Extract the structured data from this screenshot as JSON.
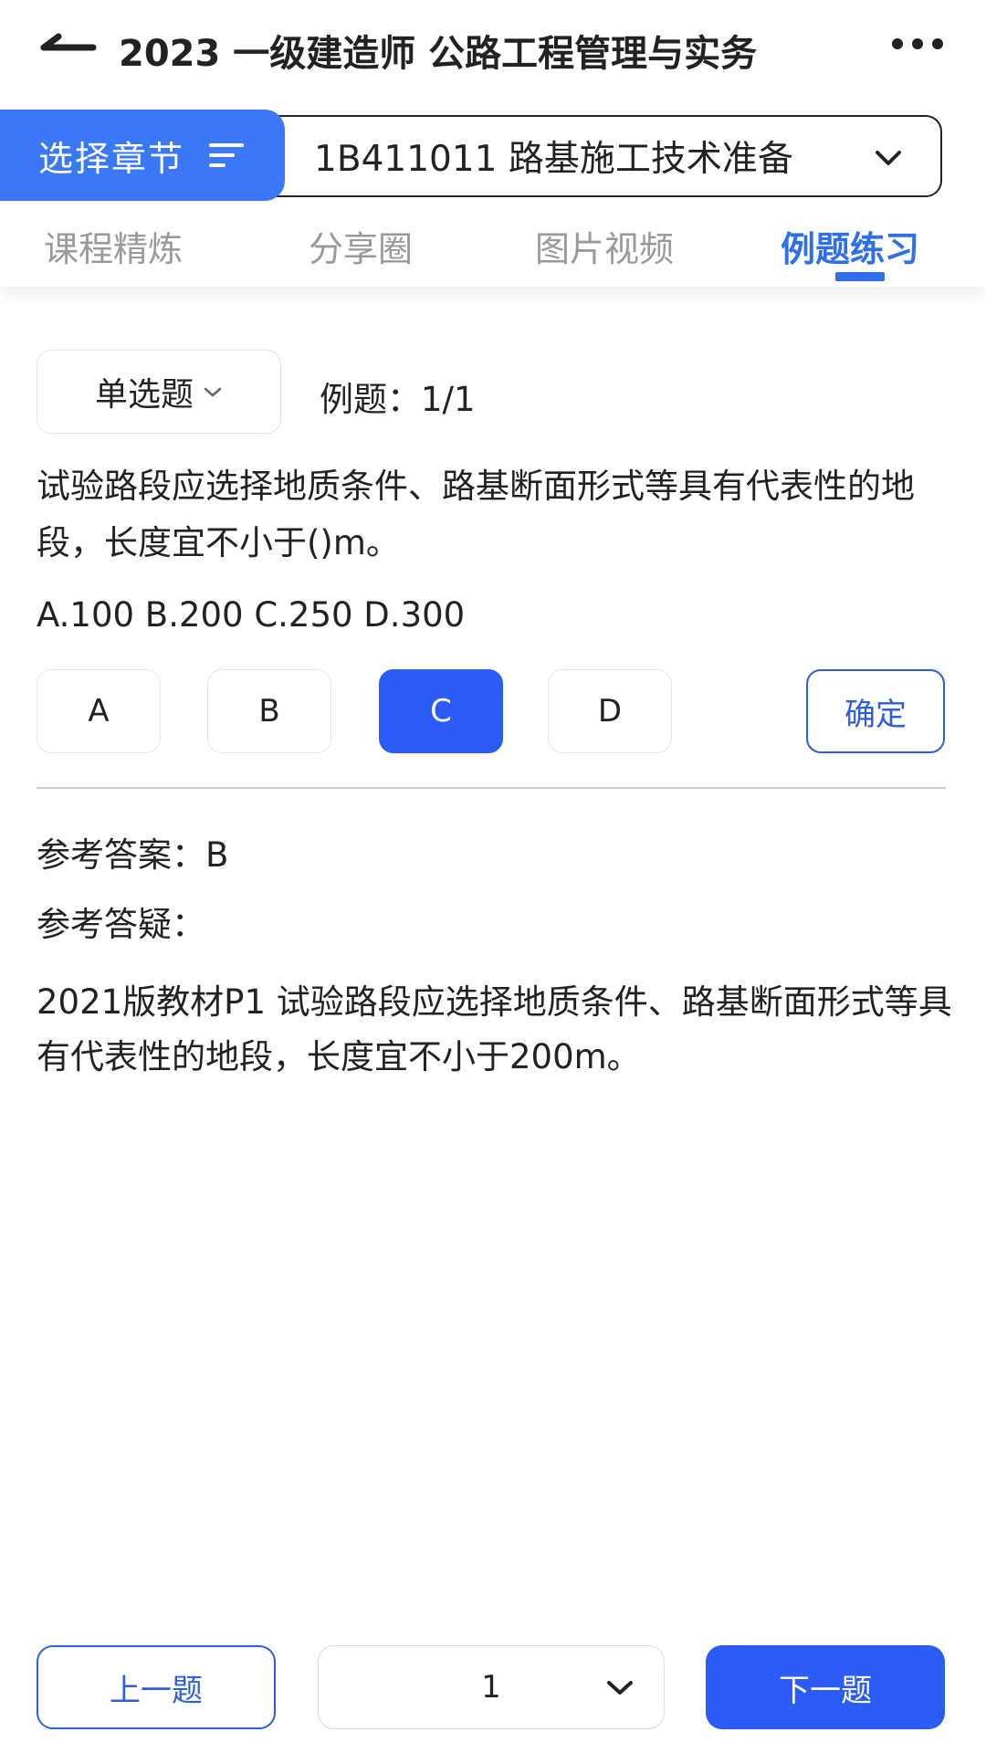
{
  "header": {
    "title": "2023 一级建造师 公路工程管理与实务",
    "back_icon": "arrow-left-icon",
    "more_icon": "more-horizontal-icon"
  },
  "chapter": {
    "button_label": "选择章节",
    "button_icon": "sort-lines-icon",
    "selected": "1B411011 路基施工技术准备",
    "dropdown_icon": "chevron-down-icon"
  },
  "tabs": [
    {
      "label": "课程精炼",
      "active": false
    },
    {
      "label": "分享圈",
      "active": false
    },
    {
      "label": "图片视频",
      "active": false
    },
    {
      "label": "例题练习",
      "active": true
    }
  ],
  "question": {
    "type": "单选题",
    "counter": "例题：1/1",
    "text": "试验路段应选择地质条件、路基断面形式等具有代表性的地段，长度宜不小于()m。",
    "choices_line": "A.100 B.200 C.250 D.300",
    "options": [
      "A",
      "B",
      "C",
      "D"
    ],
    "selected_option": "C",
    "confirm_label": "确定"
  },
  "answer": {
    "reference_answer": "参考答案：B",
    "explanation_label": "参考答疑：",
    "explanation_text": "2021版教材P1 试验路段应选择地质条件、路基断面形式等具有代表性的地段，长度宜不小于200m。"
  },
  "footer": {
    "prev_label": "上一题",
    "page_value": "1",
    "next_label": "下一题"
  },
  "colors": {
    "primary": "#2b5cf5",
    "chapter_button": "#3a78f5",
    "tab_active": "#2f6fe8",
    "tab_inactive": "#9a9a9a"
  }
}
